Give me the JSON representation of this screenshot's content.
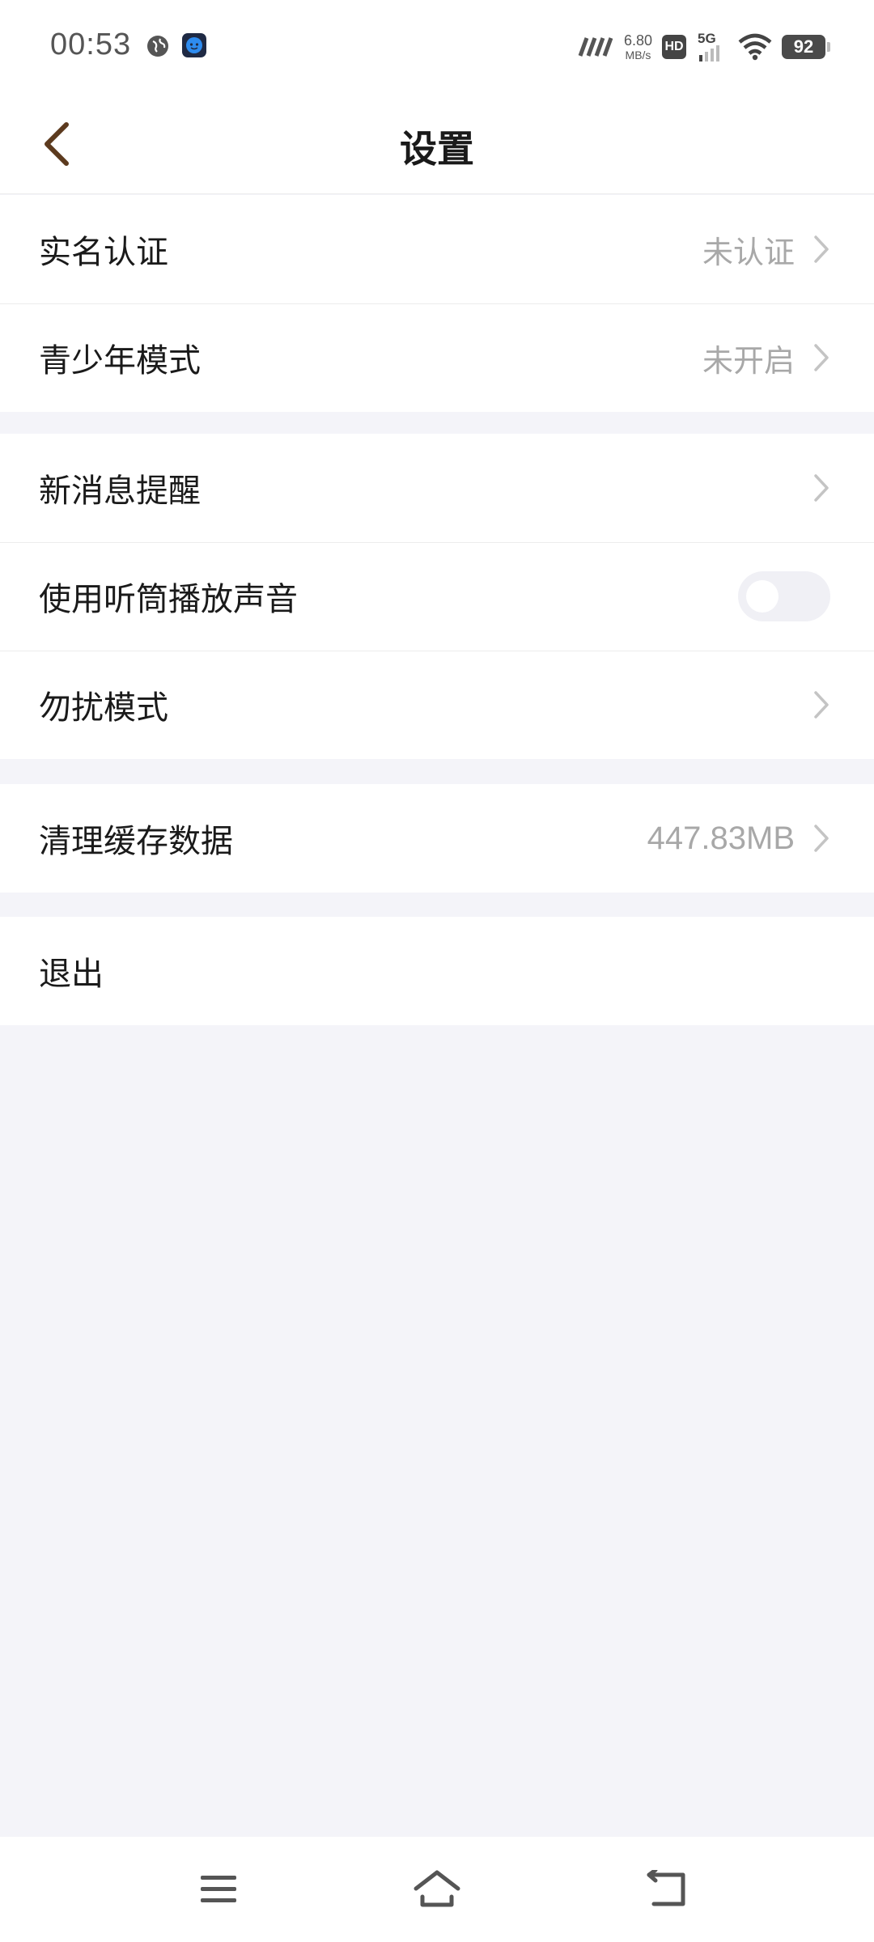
{
  "status_bar": {
    "time": "00:53",
    "net_speed_value": "6.80",
    "net_speed_unit": "MB/s",
    "hd_label": "HD",
    "network_label": "5G",
    "battery": "92"
  },
  "nav": {
    "title": "设置"
  },
  "groups": {
    "account": [
      {
        "label": "实名认证",
        "value": "未认证"
      },
      {
        "label": "青少年模式",
        "value": "未开启"
      }
    ],
    "notifications": {
      "new_message_label": "新消息提醒",
      "earpiece_label": "使用听筒播放声音",
      "earpiece_enabled": false,
      "dnd_label": "勿扰模式"
    },
    "storage": {
      "label": "清理缓存数据",
      "value": "447.83MB"
    },
    "logout": {
      "label": "退出"
    }
  },
  "colors": {
    "accent_back": "#5c3a1e",
    "page_bg": "#f4f4f9",
    "secondary_text": "#a8a8a8"
  },
  "icons": {
    "back": "chevron-left-icon",
    "row_arrow": "chevron-right-icon",
    "sys_menu": "menu-icon",
    "sys_home": "home-icon",
    "sys_back": "back-arrow-icon"
  }
}
